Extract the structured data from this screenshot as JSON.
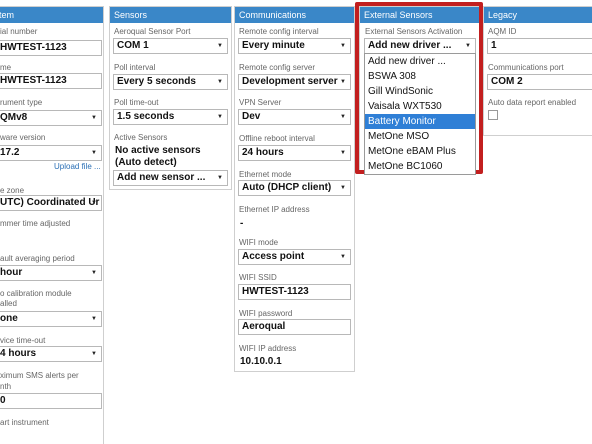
{
  "panels": {
    "system": {
      "title": "tem",
      "serial_label": "ial number",
      "serial_value": "HWTEST-1123",
      "name_label": "me",
      "name_value": "HWTEST-1123",
      "instr_type_label": "rument type",
      "instr_type_value": "QMv8",
      "sw_version_label": "ware version",
      "sw_version_value": "17.2",
      "upload_link": "Upload file ...",
      "tz_label": "e zone",
      "tz_value": "UTC) Coordinated Ur",
      "summer_label": "mmer time adjusted",
      "avg_label": "ault averaging period",
      "avg_value": "hour",
      "cal_label": "o calibration module",
      "cal_label2": "alled",
      "cal_value": "one",
      "timeout_label": "vice time-out",
      "timeout_value": "4 hours",
      "sms_label": "ximum SMS alerts per",
      "sms_label2": "nth",
      "sms_value": "0",
      "restart_label": "art instrument"
    },
    "sensors": {
      "title": "Sensors",
      "port_label": "Aeroqual Sensor Port",
      "port_value": "COM 1",
      "poll_label": "Poll interval",
      "poll_value": "Every 5 seconds",
      "timeout_label": "Poll time-out",
      "timeout_value": "1.5 seconds",
      "active_label": "Active Sensors",
      "active_value1": "No active sensors",
      "active_value2": "(Auto detect)",
      "add_value": "Add new sensor ..."
    },
    "communications": {
      "title": "Communications",
      "remote_int_label": "Remote config interval",
      "remote_int_value": "Every minute",
      "remote_srv_label": "Remote config server",
      "remote_srv_value": "Development server",
      "vpn_label": "VPN Server",
      "vpn_value": "Dev",
      "reboot_label": "Offline reboot interval",
      "reboot_value": "24 hours",
      "eth_mode_label": "Ethernet mode",
      "eth_mode_value": "Auto (DHCP client)",
      "eth_ip_label": "Ethernet IP address",
      "eth_ip_value": "-",
      "wifi_mode_label": "WIFI mode",
      "wifi_mode_value": "Access point",
      "ssid_label": "WIFI SSID",
      "ssid_value": "HWTEST-1123",
      "pw_label": "WIFI password",
      "pw_value": "Aeroqual",
      "wifi_ip_label": "WIFI IP address",
      "wifi_ip_value": "10.10.0.1"
    },
    "external": {
      "title": "External Sensors",
      "activation_label": "External Sensors Activation",
      "activation_value": "Add new driver ...",
      "options": [
        "Add new driver ...",
        "BSWA 308",
        "Gill WindSonic",
        "Vaisala WXT530",
        "Battery Monitor",
        "MetOne MSO",
        "MetOne eBAM Plus",
        "MetOne BC1060"
      ],
      "selected_option": "Battery Monitor"
    },
    "legacy": {
      "title": "Legacy",
      "aqm_label": "AQM ID",
      "aqm_value": "1",
      "port_label": "Communications port",
      "port_value": "COM 2",
      "auto_label": "Auto data report enabled"
    }
  },
  "colors": {
    "header": "#3a87c8",
    "highlight": "#c21f1f",
    "selected": "#2f7fd6"
  }
}
